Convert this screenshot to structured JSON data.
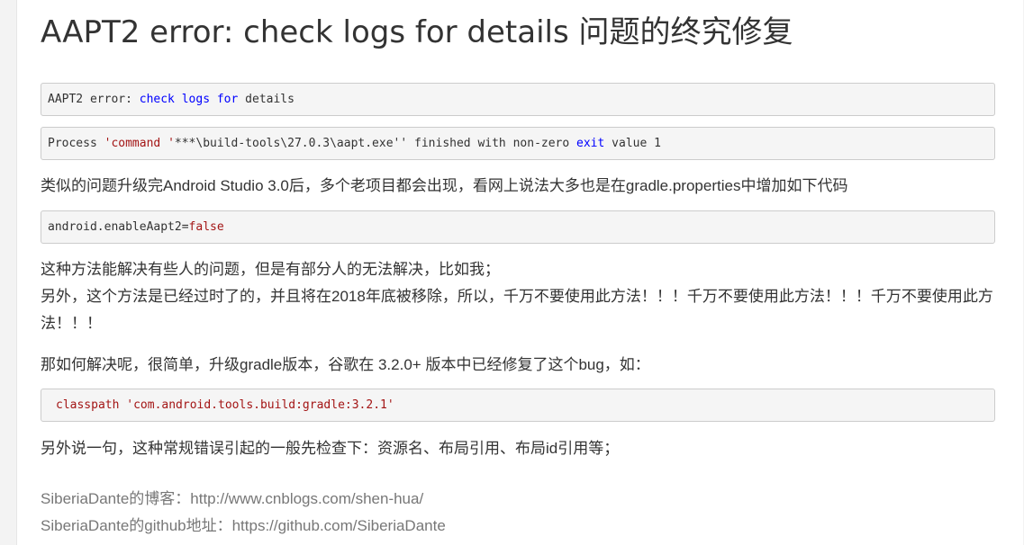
{
  "title": "AAPT2 error: check logs for details 问题的终究修复",
  "code1": {
    "a": "AAPT2 error: ",
    "b": "check",
    "c": " ",
    "d": "logs",
    "e": " ",
    "f": "for",
    "g": " details"
  },
  "code2": {
    "a": "Process ",
    "b": "'command '",
    "c": "***\\build-tools\\27.0.3\\aapt.exe''",
    "d": " finished with non-zero ",
    "e": "exit",
    "f": " value 1"
  },
  "para1": "类似的问题升级完Android Studio 3.0后，多个老项目都会出现，看网上说法大多也是在gradle.properties中增加如下代码",
  "code3": {
    "a": "android.enableAapt2=",
    "b": "false"
  },
  "para2": {
    "line1": "这种方法能解决有些人的问题，但是有部分人的无法解决，比如我；",
    "line2": "另外，这个方法是已经过时了的，并且将在2018年底被移除，所以，千万不要使用此方法！！！千万不要使用此方法！！！千万不要使用此方法！！！"
  },
  "para3": "那如何解决呢，很简单，升级gradle版本，谷歌在 3.2.0+ 版本中已经修复了这个bug，如：",
  "code4": {
    "a": "classpath 'com.android.tools.build:gradle:3.2.1'"
  },
  "para4": "另外说一句，这种常规错误引起的一般先检查下：资源名、布局引用、布局id引用等；",
  "footer": {
    "blog": "SiberiaDante的博客：http://www.cnblogs.com/shen-hua/",
    "github": "SiberiaDante的github地址：https://github.com/SiberiaDante"
  }
}
